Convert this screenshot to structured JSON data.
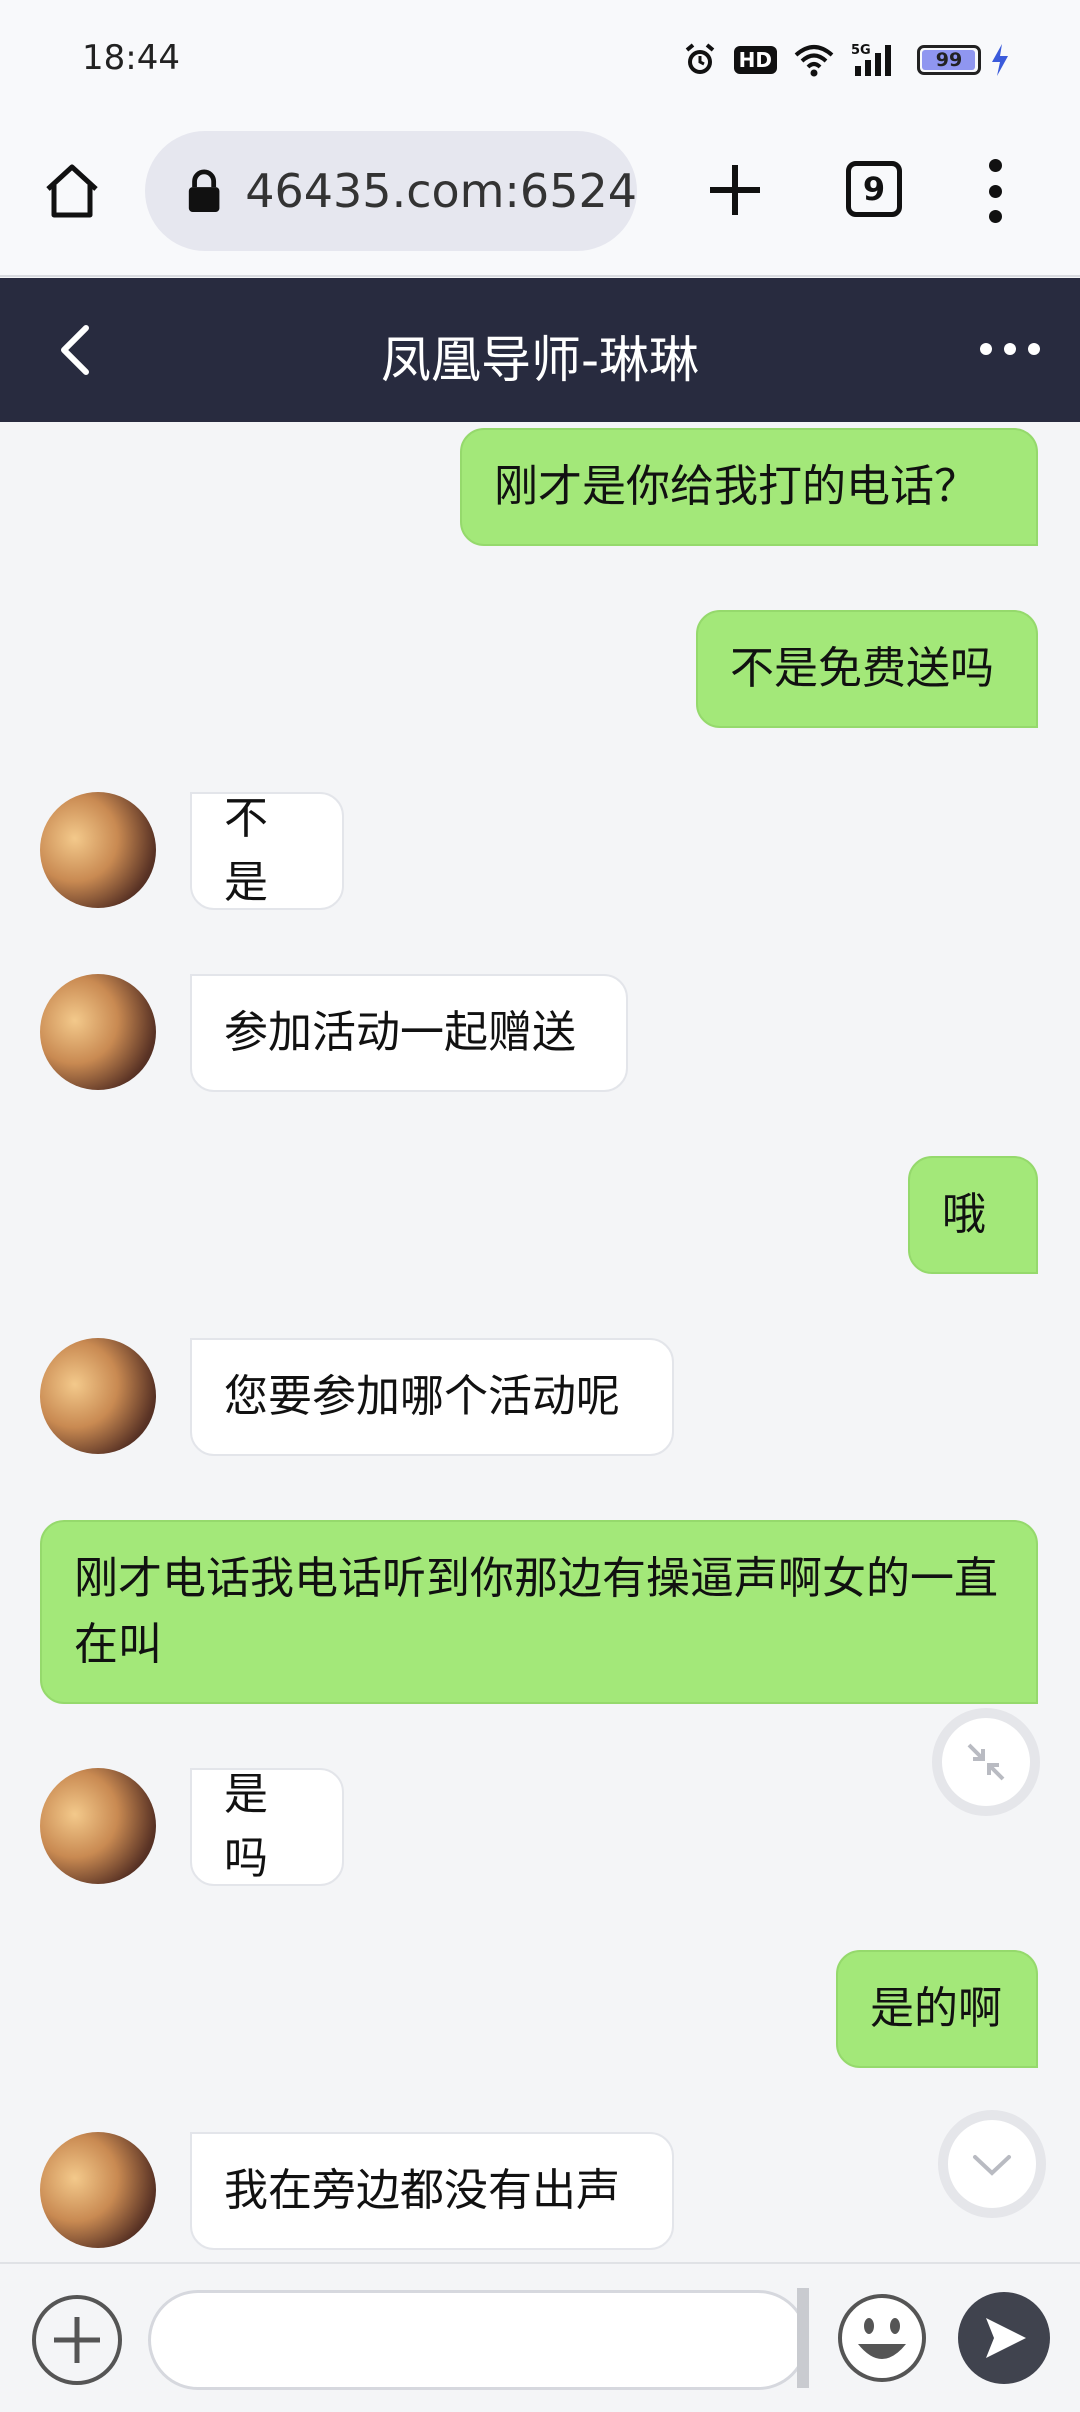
{
  "status_bar": {
    "time": "18:44",
    "hd": "HD",
    "network": "5G",
    "battery": "99",
    "battery_level": 0.99,
    "icons": [
      "alarm-icon",
      "hd-icon",
      "wifi-icon",
      "signal-5g-icon",
      "battery-icon",
      "charging-icon"
    ]
  },
  "browser": {
    "url": "46435.com:6524",
    "tab_count": "9",
    "icons": [
      "home-icon",
      "lock-icon",
      "plus-icon",
      "tabs-icon",
      "more-vert-icon"
    ]
  },
  "chat_header": {
    "title": "凤凰导师-琳琳",
    "icons": [
      "back-icon",
      "more-horizontal-icon"
    ]
  },
  "messages": [
    {
      "side": "out",
      "text": "刚才是你给我打的电话？"
    },
    {
      "side": "out",
      "text": "不是免费送吗"
    },
    {
      "side": "in",
      "text": "不是"
    },
    {
      "side": "in",
      "text": "参加活动一起赠送"
    },
    {
      "side": "out",
      "text": "哦"
    },
    {
      "side": "in",
      "text": "您要参加哪个活动呢"
    },
    {
      "side": "out",
      "text": "刚才电话我电话听到你那边有操逼声啊女的一直在叫"
    },
    {
      "side": "in",
      "text": "是吗"
    },
    {
      "side": "out",
      "text": "是的啊"
    },
    {
      "side": "in",
      "text": "我在旁边都没有出声"
    }
  ],
  "floating_buttons": [
    "collapse-icon",
    "scroll-down-icon"
  ],
  "input_bar": {
    "value": "",
    "icons": [
      "add-icon",
      "emoji-icon",
      "send-icon"
    ]
  },
  "colors": {
    "header_bg": "#282b3f",
    "outgoing_bubble": "#a3e879",
    "incoming_bubble": "#ffffff",
    "chat_bg": "#f4f5f7"
  }
}
